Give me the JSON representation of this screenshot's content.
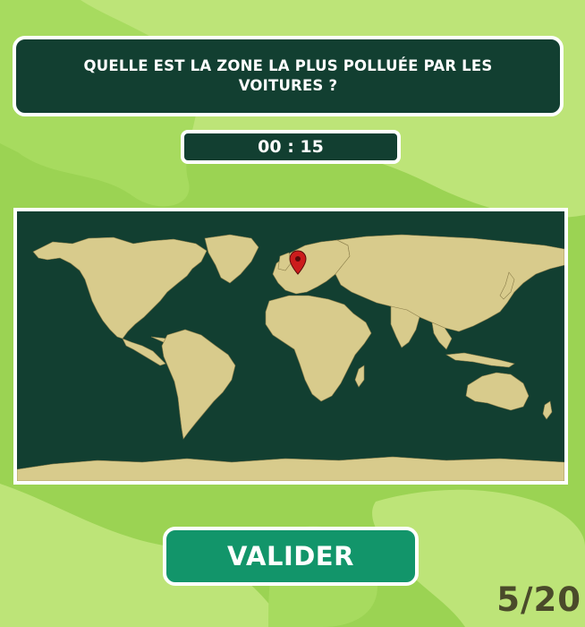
{
  "quiz": {
    "question": "QUELLE EST LA ZONE LA PLUS POLLUÉE PAR LES VOITURES ?",
    "timer": "00 : 15",
    "progress": "5/20",
    "current_question": 5,
    "total_questions": 20
  },
  "actions": {
    "validate_label": "VALIDER"
  },
  "map": {
    "marker_icon": "map-pin-icon",
    "marker_region": "Western Europe"
  },
  "colors": {
    "background_light": "#bde478",
    "background_mid": "#9bd353",
    "panel_dark": "#123f31",
    "button_green": "#12956a",
    "land": "#d8cb8c",
    "marker_red": "#cc1c1c",
    "counter_text": "#4a4a2a"
  }
}
